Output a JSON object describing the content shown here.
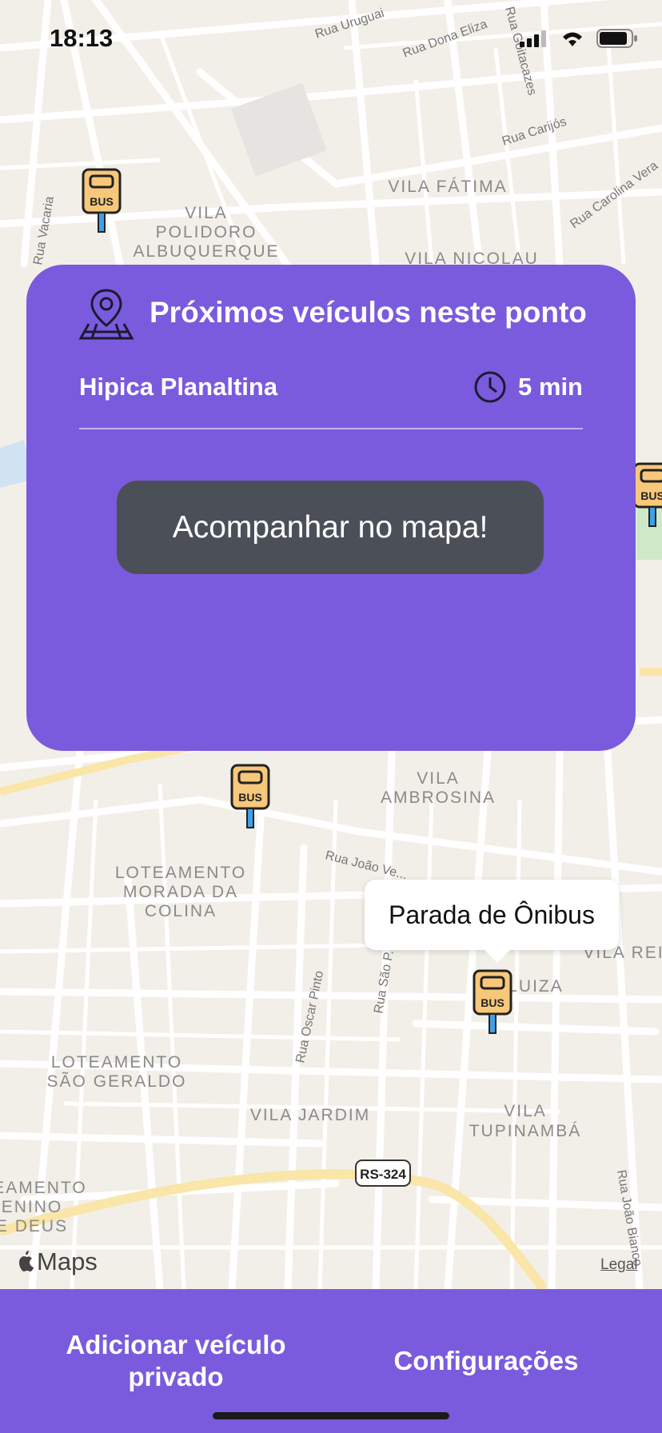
{
  "status_bar": {
    "time": "18:13"
  },
  "map": {
    "street_labels": [
      "Rua Uruguai",
      "Rua Dona Eliza",
      "Rua Goitacazes",
      "Rua Carijós",
      "Rua Carolina Vera",
      "Rua Vacaria",
      "Rua João Ve...",
      "Rua Oscar Pinto",
      "Rua São P...",
      "Rua João Bianco"
    ],
    "area_labels": [
      "VILA",
      "POLIDORO",
      "ALBUQUERQUE",
      "VILA FÁTIMA",
      "VILA NICOLAU",
      "VILA",
      "AMBROSINA",
      "LOTEAMENTO",
      "MORADA DA",
      "COLINA",
      "LOTEAMENTO",
      "SÃO GERALDO",
      "VILA JARDIM",
      "VILA",
      "TUPINAMBÁ",
      "LUIZA",
      "VILA REI",
      "EAMENTO",
      "ENINO",
      "E DEUS"
    ],
    "road_shield": "RS-324",
    "bus_stop_label": "BUS",
    "callout": "Parada de Ônibus",
    "maps_brand": "Maps",
    "legal": "Legal"
  },
  "panel": {
    "title": "Próximos veículos neste ponto",
    "route_name": "Hipica Planaltina",
    "eta": "5 min",
    "follow_button": "Acompanhar no mapa!"
  },
  "bottom_bar": {
    "add_private_vehicle": "Adicionar veículo privado",
    "settings": "Configurações"
  },
  "colors": {
    "panel": "#7a5bde",
    "button_dark": "#4b5058",
    "map_bg": "#f2efe9",
    "bus_yellow": "#f7c77a",
    "bus_pole": "#3fa0e8"
  }
}
